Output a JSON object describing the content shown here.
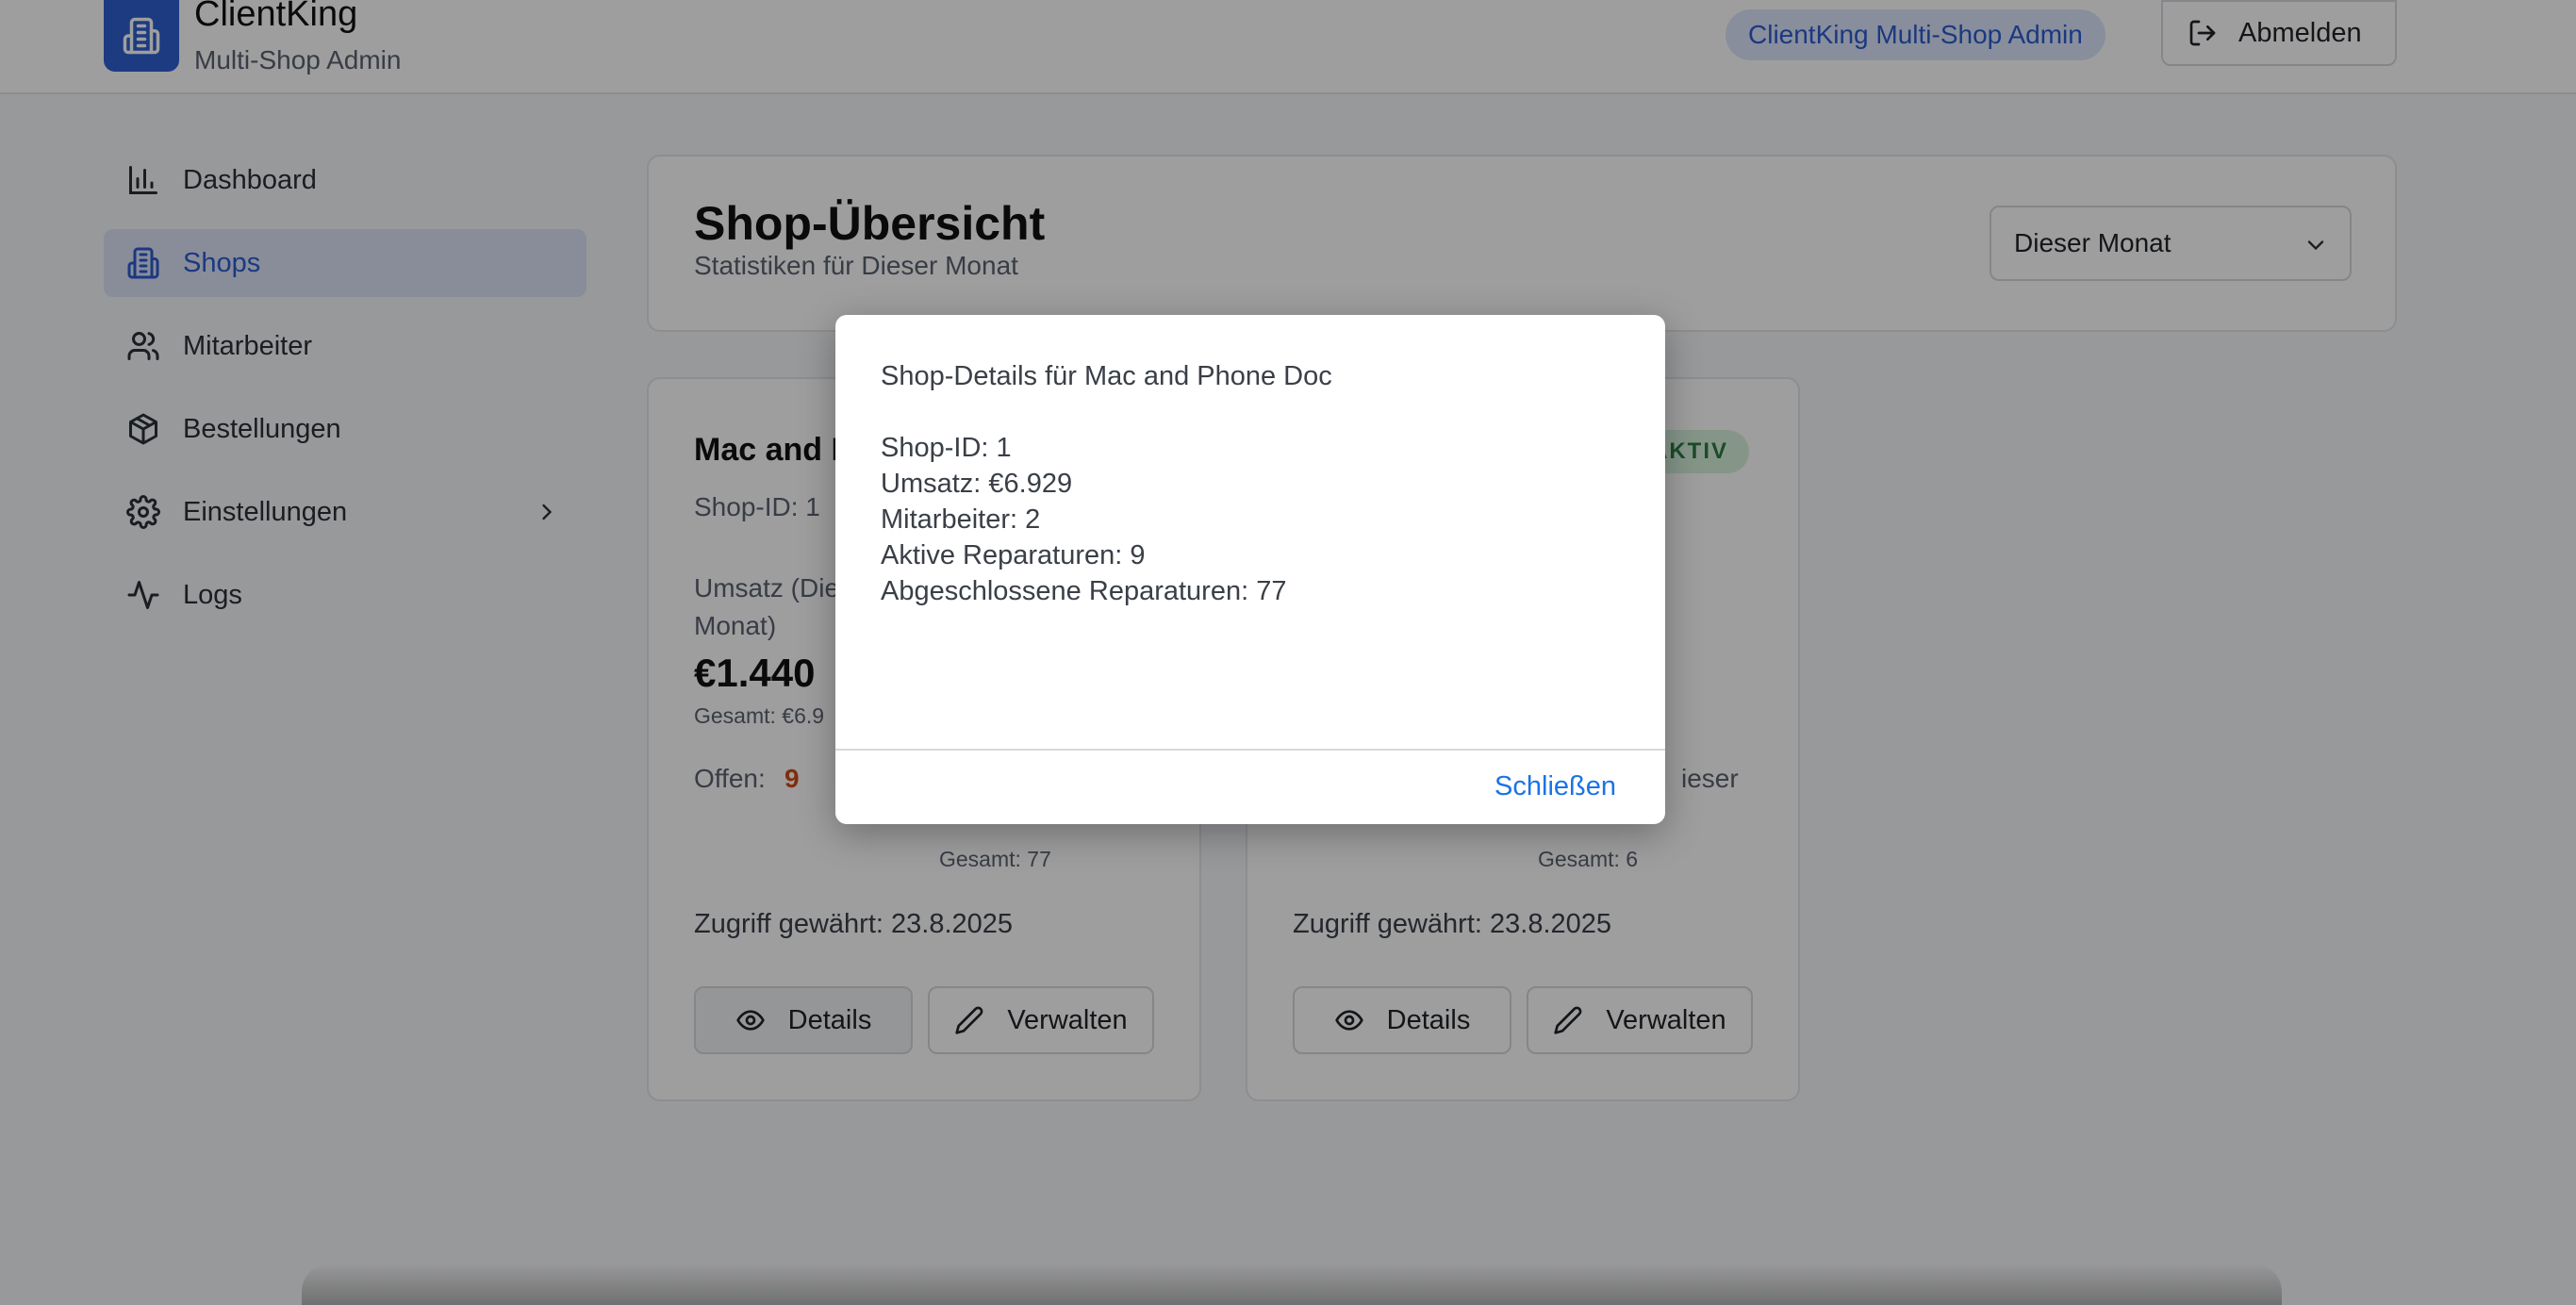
{
  "header": {
    "brand_title": "ClientKing",
    "brand_subtitle": "Multi-Shop Admin",
    "admin_badge": "ClientKing Multi-Shop Admin",
    "logout_label": "Abmelden"
  },
  "sidebar": {
    "items": [
      {
        "label": "Dashboard",
        "icon": "bar-chart-icon",
        "active": false
      },
      {
        "label": "Shops",
        "icon": "building-icon",
        "active": true
      },
      {
        "label": "Mitarbeiter",
        "icon": "users-icon",
        "active": false
      },
      {
        "label": "Bestellungen",
        "icon": "package-icon",
        "active": false
      },
      {
        "label": "Einstellungen",
        "icon": "gear-icon",
        "active": false
      },
      {
        "label": "Logs",
        "icon": "activity-icon",
        "active": false
      }
    ]
  },
  "overview": {
    "title": "Shop-Übersicht",
    "subtitle": "Statistiken für Dieser Monat",
    "period_select": "Dieser Monat"
  },
  "shops": [
    {
      "name_visible": "Mac and I",
      "shop_id": "Shop-ID: 1",
      "revenue_label_1": "Umsatz (Die",
      "revenue_label_2": "Monat)",
      "revenue_value": "€1.440",
      "revenue_total": "Gesamt: €6.9",
      "open_label": "Offen:",
      "open_value": "9",
      "completed_total": "Gesamt: 77",
      "access_granted": "Zugriff gewährt: 23.8.2025",
      "details_label": "Details",
      "manage_label": "Verwalten"
    },
    {
      "status": "AKTIV",
      "fragment_dash": "-",
      "fragment_dieser": "ieser",
      "completed_total": "Gesamt: 6",
      "access_granted": "Zugriff gewährt: 23.8.2025",
      "details_label": "Details",
      "manage_label": "Verwalten"
    }
  ],
  "dialog": {
    "title_line": "Shop-Details für Mac and Phone Doc",
    "lines": [
      "Shop-ID: 1",
      "Umsatz: €6.929",
      "Mitarbeiter: 2",
      "Aktive Reparaturen: 9",
      "Abgeschlossene Reparaturen: 77"
    ],
    "close_label": "Schließen"
  },
  "colors": {
    "accent": "#2d5bd0",
    "active_bg": "#dbe4f7",
    "open_count": "#d24a14",
    "status_bg": "#d7f2de",
    "status_text": "#2f7a45",
    "link": "#1a73e8"
  }
}
